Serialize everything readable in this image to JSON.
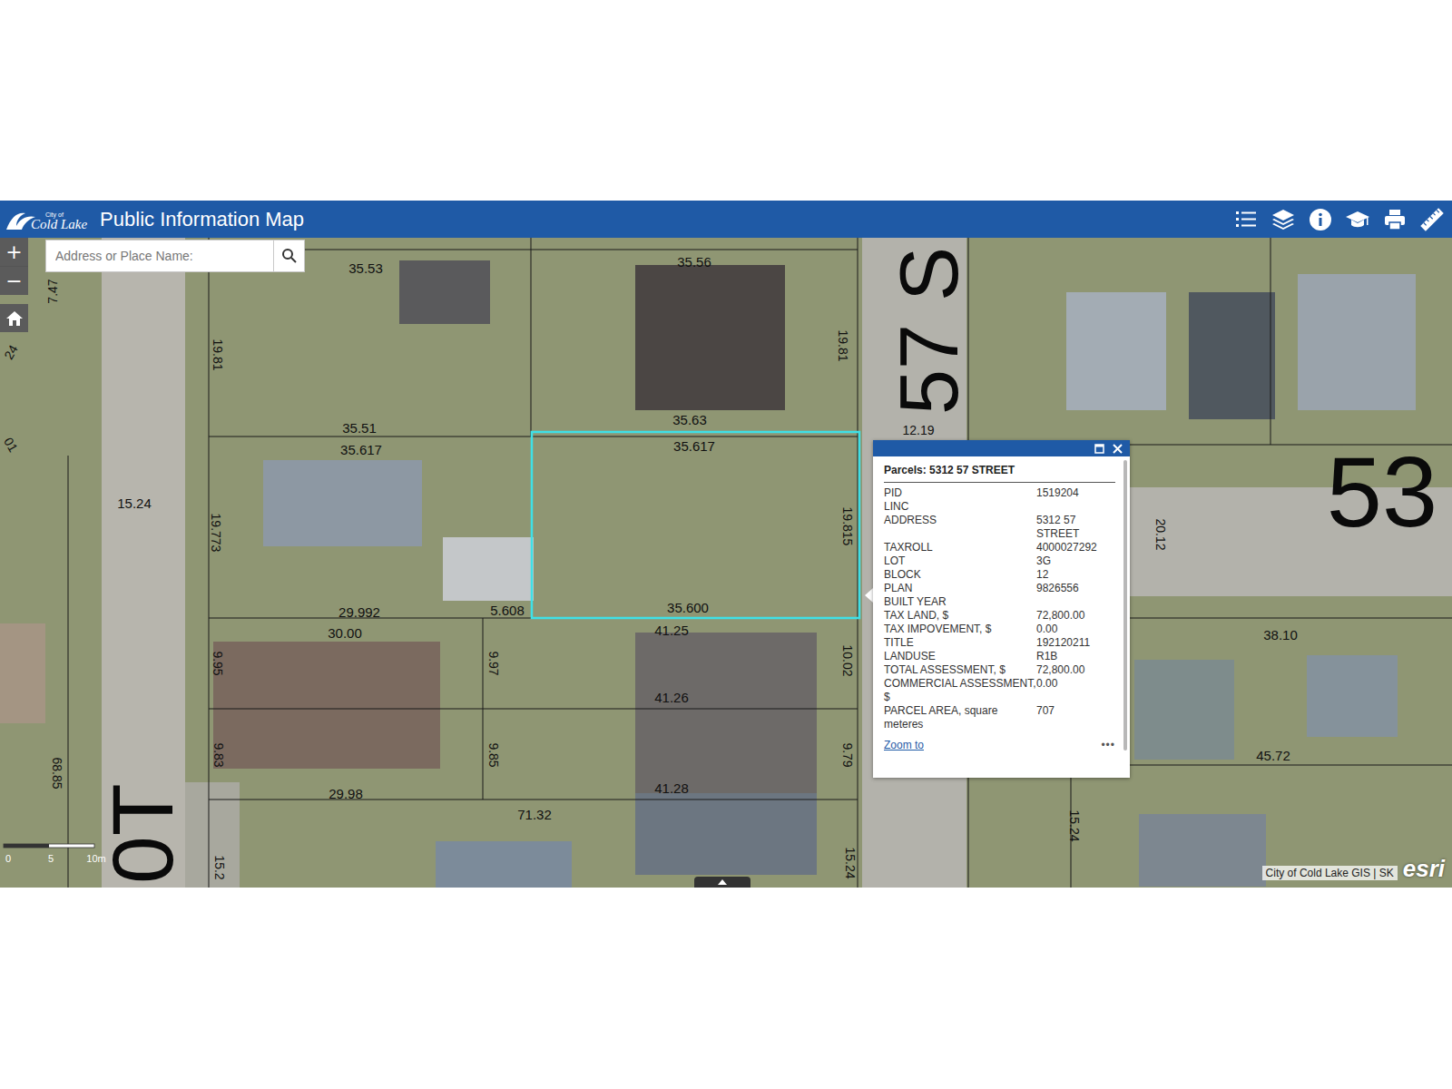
{
  "header": {
    "logo_small": "City of",
    "logo": "Cold Lake",
    "title": "Public Information Map"
  },
  "search": {
    "placeholder": "Address or Place Name:"
  },
  "zoom": {
    "in": "+",
    "out": "−"
  },
  "map": {
    "labels": [
      "35.53",
      "35.56",
      "7.47",
      "24",
      "19.81",
      "19.81",
      "12.19",
      "35.51",
      "35.63",
      "35.617",
      "35.617",
      "15.24",
      "19.773",
      "19.815",
      "20.12",
      "29.992",
      "5.608",
      "35.600",
      "30.00",
      "41.25",
      "38.10",
      "9.95",
      "9.97",
      "10.02",
      "41.26",
      "9.83",
      "9.85",
      "9.79",
      "45.72",
      "41.28",
      "29.98",
      "68.85",
      "71.32",
      "15.24",
      "15.24",
      "15.2",
      "01"
    ],
    "street_labels": [
      "57 S",
      "53",
      "0T"
    ]
  },
  "popup": {
    "title": "Parcels: 5312 57 STREET",
    "rows": [
      {
        "label": "PID",
        "value": "1519204"
      },
      {
        "label": "LINC",
        "value": ""
      },
      {
        "label": "ADDRESS",
        "value": "5312 57 STREET"
      },
      {
        "label": "TAXROLL",
        "value": "4000027292"
      },
      {
        "label": "LOT",
        "value": "3G"
      },
      {
        "label": "BLOCK",
        "value": "12"
      },
      {
        "label": "PLAN",
        "value": "9826556"
      },
      {
        "label": "BUILT YEAR",
        "value": ""
      },
      {
        "label": "TAX LAND, $",
        "value": "72,800.00"
      },
      {
        "label": "TAX IMPOVEMENT, $",
        "value": "0.00"
      },
      {
        "label": "TITLE",
        "value": "192120211"
      },
      {
        "label": "LANDUSE",
        "value": "R1B"
      },
      {
        "label": "TOTAL ASSESSMENT, $",
        "value": "72,800.00"
      },
      {
        "label": "COMMERCIAL ASSESSMENT, $",
        "value": "0.00"
      },
      {
        "label": "PARCEL AREA, square meteres",
        "value": "707"
      }
    ],
    "link": "Zoom to",
    "more": "•••"
  },
  "scale": [
    "0",
    "5",
    "10m"
  ],
  "attribution": "City of Cold Lake GIS | SK",
  "brand": "esri"
}
